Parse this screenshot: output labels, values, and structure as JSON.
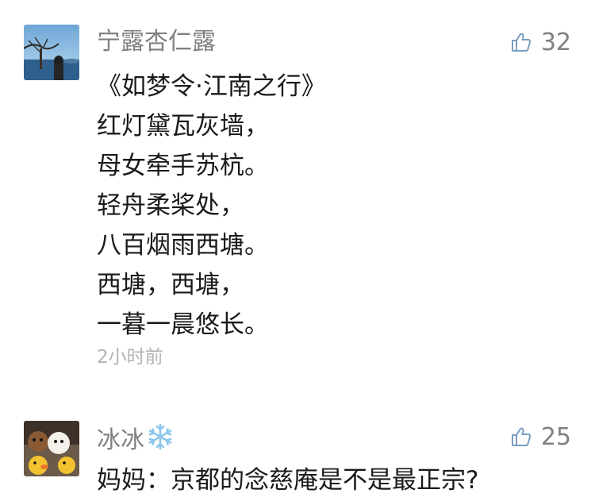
{
  "comments": [
    {
      "nickname": "宁露杏仁露",
      "likes": "32",
      "content_lines": [
        "《如梦令·江南之行》",
        "红灯黛瓦灰墙，",
        "母女牵手苏杭。",
        "轻舟柔桨处，",
        "八百烟雨西塘。",
        "西塘，西塘，",
        "一暮一晨悠长。"
      ],
      "time": "2小时前"
    },
    {
      "nickname": "冰冰",
      "nickname_emoji": "snowflake-icon",
      "likes": "25",
      "content_lines": [
        "妈妈：京都的念慈庵是不是最正宗?"
      ]
    }
  ],
  "colors": {
    "meta_gray": "#808080",
    "text": "#1a1a1a",
    "time_gray": "#b3b3b3",
    "snowflake_blue": "#8cc6ec"
  }
}
